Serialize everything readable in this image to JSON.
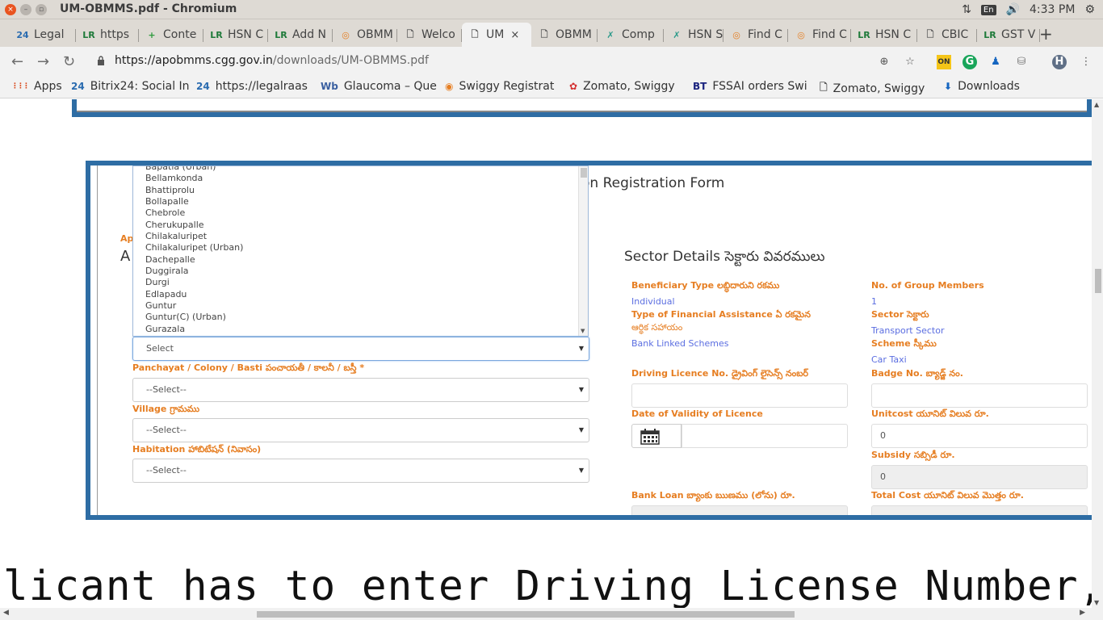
{
  "window": {
    "title": "UM-OBMMS.pdf - Chromium",
    "time": "4:33 PM",
    "keyboard": "En"
  },
  "tabs": [
    {
      "icon": "bitrix24-icon",
      "glyph": "24",
      "label": "Legal",
      "color": "#2b6cb0"
    },
    {
      "icon": "legalraasta-icon",
      "glyph": "LR",
      "label": "https",
      "color": "#1f7a3a"
    },
    {
      "icon": "plus-box-icon",
      "glyph": "+",
      "label": "Conte",
      "color": "#2e9b3e"
    },
    {
      "icon": "legalraasta-icon",
      "glyph": "LR",
      "label": "HSN C",
      "color": "#1f7a3a"
    },
    {
      "icon": "legalraasta-icon",
      "glyph": "LR",
      "label": "Add N",
      "color": "#1f7a3a"
    },
    {
      "icon": "chrome-ring-icon",
      "glyph": "◎",
      "label": "OBMM",
      "color": "#e67e22"
    },
    {
      "icon": "page-icon",
      "glyph": "🗋",
      "label": "Welco",
      "color": "#555"
    },
    {
      "icon": "page-icon",
      "glyph": "🗋",
      "label": "UM",
      "color": "#555"
    },
    {
      "icon": "page-icon",
      "glyph": "🗋",
      "label": "OBMM",
      "color": "#555"
    },
    {
      "icon": "cbic-icon",
      "glyph": "✗",
      "label": "Comp",
      "color": "#2e9b8b"
    },
    {
      "icon": "cbic-icon",
      "glyph": "✗",
      "label": "HSN S",
      "color": "#2e9b8b"
    },
    {
      "icon": "chrome-ring-icon",
      "glyph": "◎",
      "label": "Find C",
      "color": "#e67e22"
    },
    {
      "icon": "chrome-ring-icon",
      "glyph": "◎",
      "label": "Find C",
      "color": "#e67e22"
    },
    {
      "icon": "legalraasta-icon",
      "glyph": "LR",
      "label": "HSN C",
      "color": "#1f7a3a"
    },
    {
      "icon": "page-icon",
      "glyph": "🗋",
      "label": "CBIC",
      "color": "#555"
    },
    {
      "icon": "legalraasta-icon",
      "glyph": "LR",
      "label": "GST V",
      "color": "#1f7a3a"
    }
  ],
  "toolbar": {
    "url_host": "https://apobmms.cgg.gov.in",
    "url_path": "/downloads/UM-OBMMS.pdf",
    "avatar": "H"
  },
  "bookmarks": [
    {
      "icon": "apps-grid-icon",
      "glyph": "⋮⋮⋮",
      "label": "Apps",
      "color": "#d84315"
    },
    {
      "icon": "bitrix24-icon",
      "glyph": "24",
      "label": "Bitrix24: Social In",
      "color": "#2b6cb0"
    },
    {
      "icon": "bitrix24-icon",
      "glyph": "24",
      "label": "https://legalraas",
      "color": "#2b6cb0"
    },
    {
      "icon": "webmd-icon",
      "glyph": "Wb",
      "label": "Glaucoma – Que",
      "color": "#3a5fa0"
    },
    {
      "icon": "swiggy-icon",
      "glyph": "◉",
      "label": "Swiggy Registrat",
      "color": "#e67e22"
    },
    {
      "icon": "zomato-icon",
      "glyph": "✿",
      "label": "Zomato, Swiggy",
      "color": "#d32f2f"
    },
    {
      "icon": "bt-icon",
      "glyph": "BT",
      "label": "FSSAI orders Swi",
      "color": "#1a237e"
    },
    {
      "icon": "page-icon",
      "glyph": "🗋",
      "label": "Zomato, Swiggy",
      "color": "#555"
    },
    {
      "icon": "download-icon",
      "glyph": "⬇",
      "label": "Downloads",
      "color": "#1565c0"
    }
  ],
  "form": {
    "title_fragment": "on Registration Form",
    "applicant_small": "Ap",
    "applicant_big": "A",
    "mandal_list": [
      "Bapatla (Urban)",
      "Bellamkonda",
      "Bhattiprolu",
      "Bollapalle",
      "Chebrole",
      "Cherukupalle",
      "Chilakaluripet",
      "Chilakaluripet (Urban)",
      "Dachepalle",
      "Duggirala",
      "Durgi",
      "Edlapadu",
      "Guntur",
      "Guntur(C) (Urban)",
      "Gurazala"
    ],
    "mandal_select": "Select",
    "panchayat_label": "Panchayat / Colony / Basti పంచాయతీ / కాలనీ / బస్తీ *",
    "panchayat_value": "--Select--",
    "village_label": "Village గ్రామము",
    "village_value": "--Select--",
    "habitation_label": "Habitation హాబిటేషన్ (నివాసం)",
    "habitation_value": "--Select--"
  },
  "sector": {
    "title": "Sector Details సెక్టారు వివరములు",
    "beneficiary_type_label": "Beneficiary Type లబ్ధిదారుని రకము",
    "beneficiary_type_value": "Individual",
    "group_members_label": "No. of Group Members",
    "group_members_value": "1",
    "financial_label_1": "Type of Financial Assistance ఏ రకమైన",
    "financial_label_2": "ఆర్థిక సహాయం",
    "financial_value": "Bank Linked Schemes",
    "sector_label": "Sector సెక్టారు",
    "sector_value": "Transport Sector",
    "scheme_label": "Scheme స్కీము",
    "scheme_value": "Car Taxi",
    "licence_label": "Driving Licence No. డ్రైవింగ్ లైసెన్స్ నంబర్",
    "badge_label": "Badge No. బ్యాడ్జ్ నం.",
    "validity_label": "Date of Validity of Licence",
    "unitcost_label": "Unitcost యూనిట్ విలువ రూ.",
    "unitcost_value": "0",
    "subsidy_label": "Subsidy సబ్సిడీ రూ.",
    "subsidy_value": "0",
    "bankloan_label": "Bank Loan బ్యాంకు ఋణము (లోను) రూ.",
    "totalcost_label": "Total Cost యూనిట్ విలువ మొత్తం రూ."
  },
  "pdf_text": "licant has to enter Driving License Number, validity da"
}
